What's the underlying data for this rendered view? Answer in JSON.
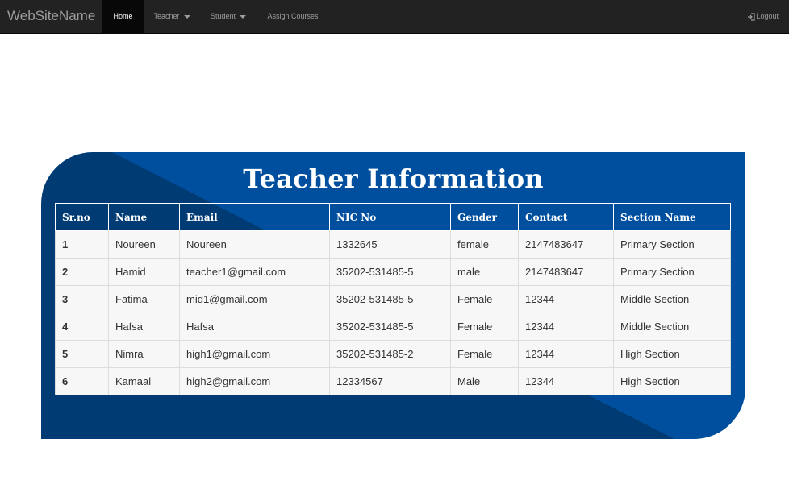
{
  "nav": {
    "brand": "WebSiteName",
    "home": "Home",
    "teacher": "Teacher",
    "student": "Student",
    "assign": "Assign Courses",
    "logout": "Logout"
  },
  "card": {
    "title": "Teacher Information",
    "accent_dark": "#003b73",
    "accent_light": "#004f9e"
  },
  "table": {
    "headers": [
      "Sr.no",
      "Name",
      "Email",
      "NIC No",
      "Gender",
      "Contact",
      "Section Name"
    ],
    "rows": [
      [
        "1",
        "Noureen",
        "Noureen",
        "1332645",
        "female",
        "2147483647",
        "Primary Section"
      ],
      [
        "2",
        "Hamid",
        "teacher1@gmail.com",
        "35202-531485-5",
        "male",
        "2147483647",
        "Primary Section"
      ],
      [
        "3",
        "Fatima",
        "mid1@gmail.com",
        "35202-531485-5",
        "Female",
        "12344",
        "Middle Section"
      ],
      [
        "4",
        "Hafsa",
        "Hafsa",
        "35202-531485-5",
        "Female",
        "12344",
        "Middle Section"
      ],
      [
        "5",
        "Nimra",
        "high1@gmail.com",
        "35202-531485-2",
        "Female",
        "12344",
        "High Section"
      ],
      [
        "6",
        "Kamaal",
        "high2@gmail.com",
        "12334567",
        "Male",
        "12344",
        "High Section"
      ]
    ]
  }
}
